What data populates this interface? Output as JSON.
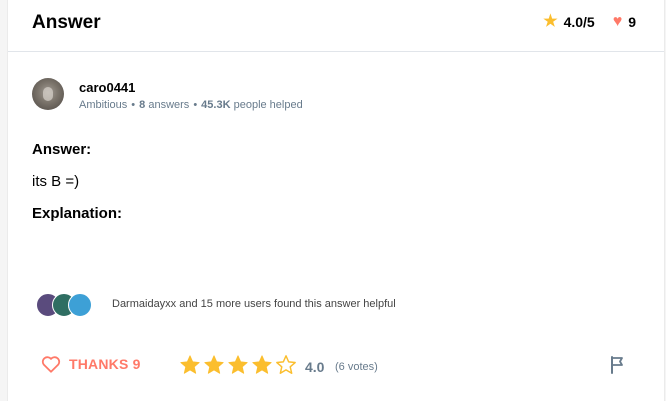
{
  "header": {
    "title": "Answer",
    "rating": "4.0/5",
    "hearts": "9",
    "icons": {
      "rating": "star-icon",
      "hearts": "heart-icon"
    }
  },
  "author": {
    "username": "caro0441",
    "rank": "Ambitious",
    "answers_count": "8",
    "answers_label": "answers",
    "helped_count": "45.3K",
    "helped_label": "people helped"
  },
  "content": {
    "answer_label": "Answer:",
    "answer_text": "its B =)",
    "explanation_label": "Explanation:"
  },
  "helpers": {
    "text": "Darmaidayxx and 15 more users found this answer helpful"
  },
  "footer": {
    "thanks_label": "THANKS 9",
    "rating_value": "4.0",
    "votes": "(6 votes)",
    "stars_filled": 4,
    "stars_total": 5
  },
  "colors": {
    "star": "#fbbe2e",
    "heart": "#ff7968",
    "muted": "#687b8c"
  }
}
